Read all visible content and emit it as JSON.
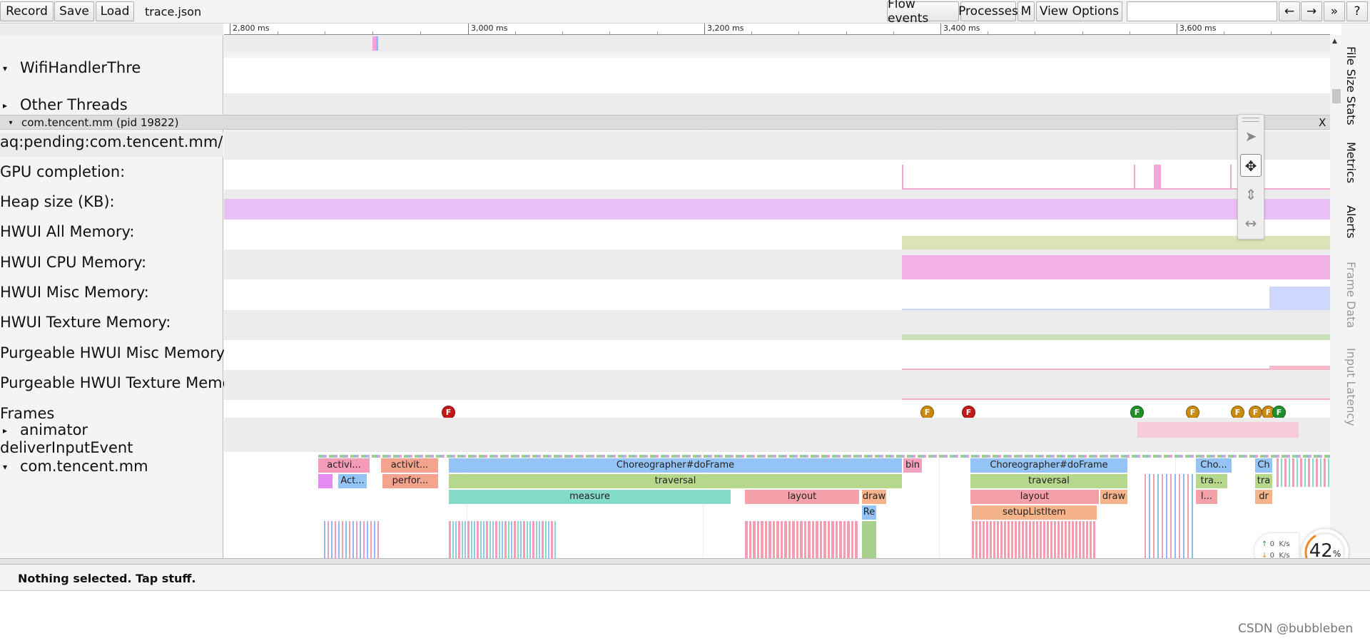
{
  "toolbar": {
    "record": "Record",
    "save": "Save",
    "load": "Load",
    "filename": "trace.json",
    "flow_events": "Flow events",
    "processes": "Processes",
    "m": "M",
    "view_options": "View Options",
    "back_arrow": "←",
    "forward_arrow": "→",
    "more": "»",
    "help": "?"
  },
  "ruler": {
    "ticks": [
      "2,800 ms",
      "3,000 ms",
      "3,200 ms",
      "3,400 ms",
      "3,600 ms"
    ]
  },
  "threads": {
    "wifi": "WifiHandlerThre",
    "other": "Other Threads"
  },
  "process": {
    "header": "com.tencent.mm (pid 19822)",
    "close": "X"
  },
  "counters": {
    "aq": "aq:pending:com.tencent.mm/co",
    "gpu": "GPU completion:",
    "heap": "Heap size (KB):",
    "hwui_all": "HWUI All Memory:",
    "hwui_cpu": "HWUI CPU Memory:",
    "hwui_misc": "HWUI Misc Memory:",
    "hwui_tex": "HWUI Texture Memory:",
    "purge_misc": "Purgeable HWUI Misc Memory:",
    "purge_tex": "Purgeable HWUI Texture Memo",
    "frames": "Frames",
    "animator": "animator",
    "deliver": "deliverInputEvent",
    "main_thread": "com.tencent.mm"
  },
  "frame_markers": [
    {
      "label": "F",
      "color": "#c21a1a"
    },
    {
      "label": "F",
      "color": "#c98a0f"
    },
    {
      "label": "F",
      "color": "#c21a1a"
    },
    {
      "label": "F",
      "color": "#1f8f2a"
    },
    {
      "label": "F",
      "color": "#c98a0f"
    },
    {
      "label": "F",
      "color": "#c98a0f"
    },
    {
      "label": "F",
      "color": "#c98a0f"
    },
    {
      "label": "F",
      "color": "#c98a0f"
    },
    {
      "label": "F",
      "color": "#1f8f2a"
    }
  ],
  "slices": {
    "s1": "activi...",
    "s2": "activit...",
    "s3": "Choreographer#doFrame",
    "s4": "bin",
    "s5": "Choreographer#doFrame",
    "s6": "Cho...",
    "s7": "Ch",
    "s8": "Act...",
    "s9": "perfor...",
    "s10": "traversal",
    "s11": "traversal",
    "s12": "tra...",
    "s13": "tra",
    "s14": "measure",
    "s15": "layout",
    "s16": "draw",
    "s17": "layout",
    "s18": "draw",
    "s19": "l...",
    "s20": "dr",
    "s21": "Re",
    "s22": "setupListItem"
  },
  "side_tabs": [
    "File Size Stats",
    "Metrics",
    "Alerts",
    "Frame Data",
    "Input Latency"
  ],
  "status": "Nothing selected. Tap stuff.",
  "net": {
    "up": "0",
    "down": "0",
    "unit": "K/s"
  },
  "cpu": "42",
  "watermark": "CSDN @bubbleben"
}
